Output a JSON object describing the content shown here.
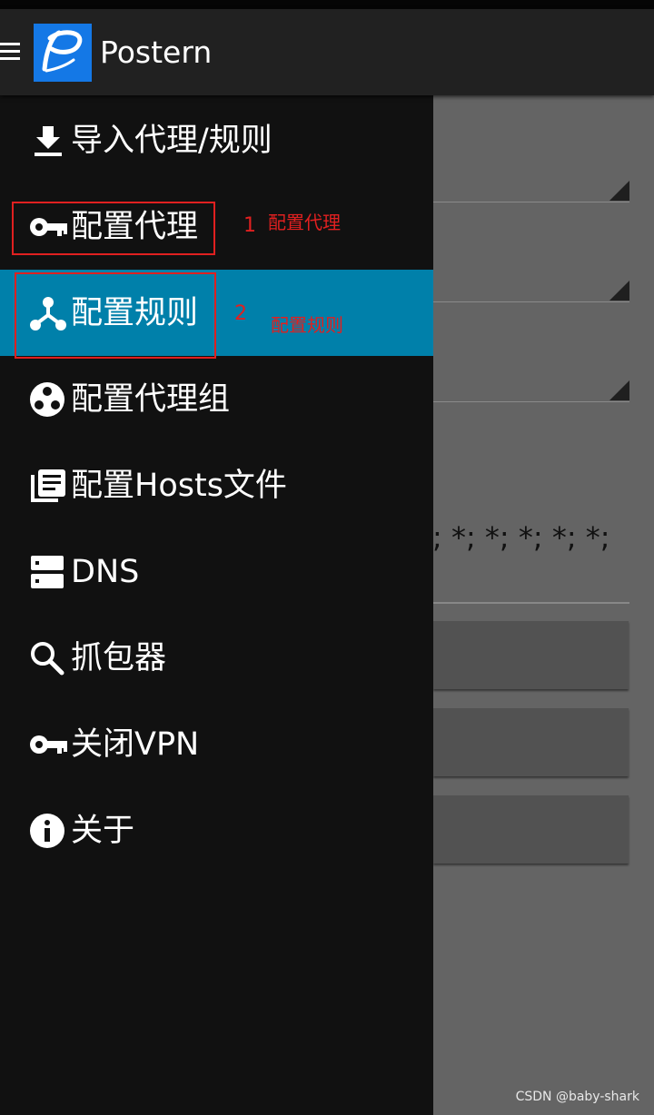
{
  "app": {
    "title": "Postern",
    "logo_letter": "P"
  },
  "background": {
    "placeholder_text": "*; *; *; *; *; *;"
  },
  "drawer": {
    "items": [
      {
        "label": "导入代理/规则",
        "icon": "download-icon",
        "active": false
      },
      {
        "label": "配置代理",
        "icon": "key-icon",
        "active": false
      },
      {
        "label": "配置规则",
        "icon": "share-nodes-icon",
        "active": true
      },
      {
        "label": "配置代理组",
        "icon": "group-circle-icon",
        "active": false
      },
      {
        "label": "配置Hosts文件",
        "icon": "library-icon",
        "active": false
      },
      {
        "label": "DNS",
        "icon": "server-icon",
        "active": false
      },
      {
        "label": "抓包器",
        "icon": "search-icon",
        "active": false
      },
      {
        "label": "关闭VPN",
        "icon": "key-icon",
        "active": false
      },
      {
        "label": "关于",
        "icon": "info-icon",
        "active": false
      }
    ]
  },
  "annotations": [
    {
      "number": "1",
      "text": "配置代理"
    },
    {
      "number": "2",
      "text": "配置规则"
    }
  ],
  "colors": {
    "active_item": "#0080aa",
    "logo_bg": "#1478e6",
    "annotation": "#e02020"
  },
  "watermark": "CSDN @baby-shark"
}
